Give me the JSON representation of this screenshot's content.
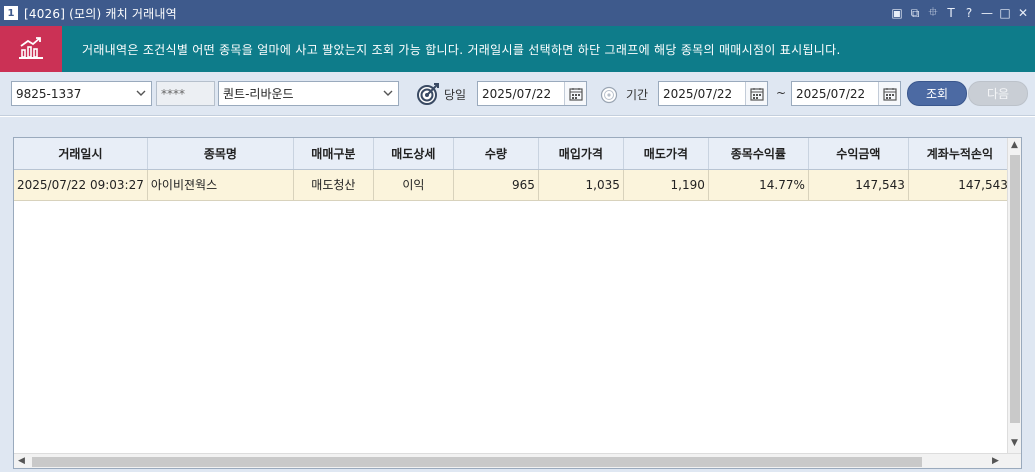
{
  "window": {
    "number": "1",
    "title": "[4026] (모의) 캐치 거래내역",
    "controls": [
      "layout-icon",
      "restore-icon",
      "pin-icon",
      "font-icon",
      "help-icon",
      "minimize-icon",
      "maximize-icon",
      "close-icon"
    ],
    "control_glyphs": [
      "▣",
      "⧉",
      "⯐",
      "T",
      "?",
      "—",
      "□",
      "✕"
    ]
  },
  "banner": {
    "icon": "chart-icon",
    "text": "거래내역은 조건식별 어떤 종목을 얼마에 사고 팔았는지 조회 가능 합니다. 거래일시를 선택하면 하단 그래프에 해당 종목의 매매시점이 표시됩니다.",
    "icon_color": "#cb3155",
    "color": "#0e7c8a"
  },
  "toolbar": {
    "account": "9825-1337",
    "password": "****",
    "strategy": "퀀트-리바운드",
    "today_label": "당일",
    "today_date": "2025/07/22",
    "period_label": "기간",
    "period_start": "2025/07/22",
    "tilde": "~",
    "period_end": "2025/07/22",
    "search_label": "조회",
    "next_label": "다음"
  },
  "table": {
    "columns": [
      "거래일시",
      "종목명",
      "매매구분",
      "매도상세",
      "수량",
      "매입가격",
      "매도가격",
      "종목수익률",
      "수익금액",
      "계좌누적손익"
    ],
    "rows": [
      [
        "2025/07/22 09:03:27",
        "아이비젼웍스",
        "매도청산",
        "이익",
        "965",
        "1,035",
        "1,190",
        "14.77%",
        "147,543",
        "147,543"
      ]
    ]
  }
}
